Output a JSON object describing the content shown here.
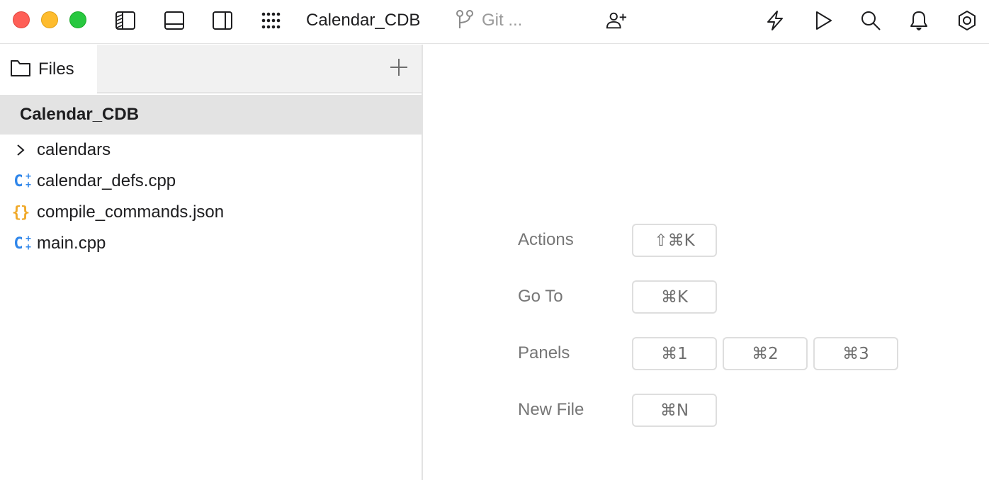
{
  "window": {
    "title": "Calendar_CDB",
    "traffic_lights": [
      "close",
      "minimize",
      "zoom"
    ],
    "colors": {
      "close": "#fe5f57",
      "minimize": "#febc2e",
      "zoom": "#28c840"
    }
  },
  "toolbar": {
    "left_icons": [
      "toggle-left-sidebar-icon",
      "toggle-bottom-panel-icon",
      "toggle-right-sidebar-icon",
      "apps-grid-icon"
    ],
    "project_title": "Calendar_CDB",
    "git_label": "Git ...",
    "collab_icon": "add-user-icon",
    "right_icons": [
      "bolt-icon",
      "run-icon",
      "search-icon",
      "bell-icon",
      "settings-icon"
    ]
  },
  "sidebar": {
    "tab_label": "Files",
    "tab_icon": "folder-icon",
    "add_icon": "plus-icon",
    "root_label": "Calendar_CDB",
    "items": [
      {
        "label": "calendars",
        "type": "folder",
        "icon": "chevron-right-icon"
      },
      {
        "label": "calendar_defs.cpp",
        "type": "cpp",
        "icon": "cpp-file-icon"
      },
      {
        "label": "compile_commands.json",
        "type": "json",
        "icon": "json-file-icon"
      },
      {
        "label": "main.cpp",
        "type": "cpp",
        "icon": "cpp-file-icon"
      }
    ],
    "icon_colors": {
      "cpp": "#2f86ea",
      "json": "#f0a92a"
    }
  },
  "welcome": {
    "shortcuts": [
      {
        "label": "Actions",
        "keys": [
          "⇧⌘K"
        ]
      },
      {
        "label": "Go To",
        "keys": [
          "⌘K"
        ]
      },
      {
        "label": "Panels",
        "keys": [
          "⌘1",
          "⌘2",
          "⌘3"
        ]
      },
      {
        "label": "New File",
        "keys": [
          "⌘N"
        ]
      }
    ]
  }
}
